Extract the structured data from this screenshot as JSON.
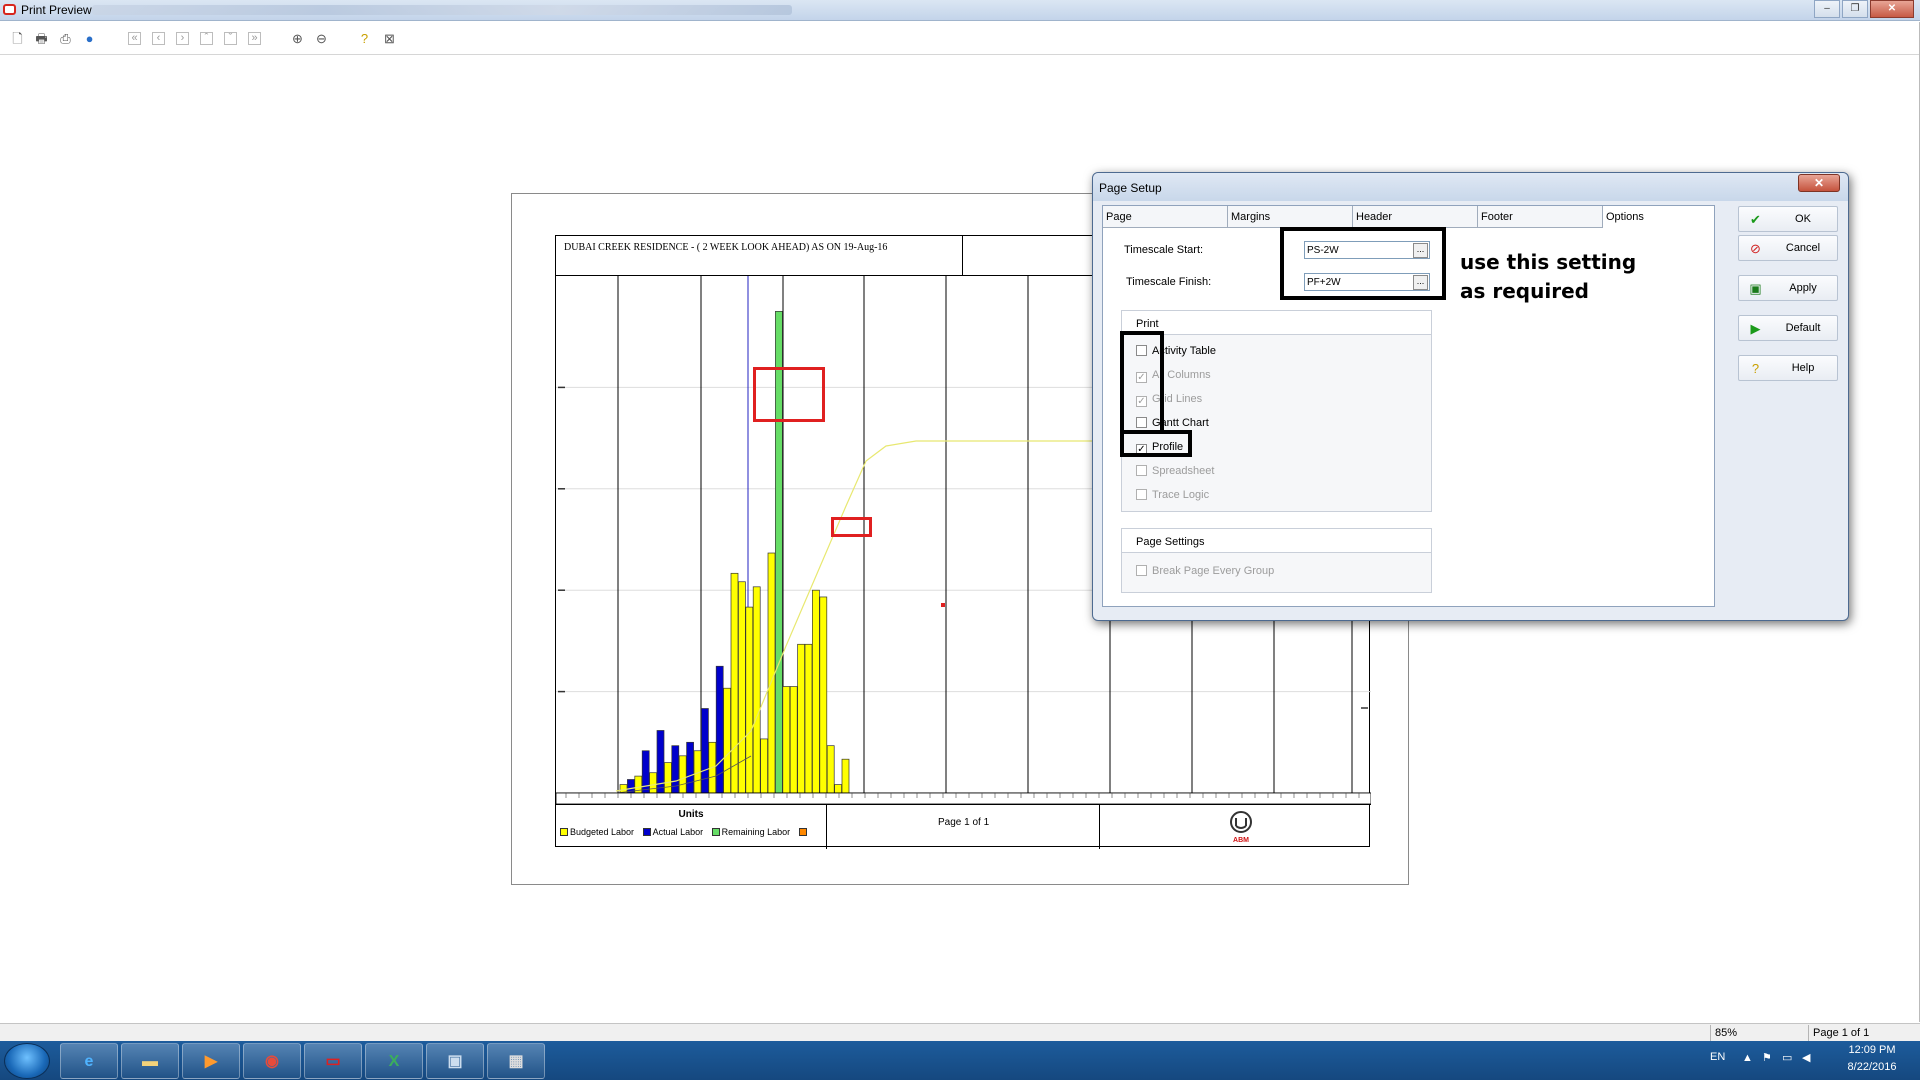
{
  "window": {
    "title": "Print Preview",
    "minimize": "–",
    "restore": "❐",
    "close": "✕"
  },
  "toolbar": {
    "icons": [
      "page-setup-icon",
      "print-preview-icon",
      "print-icon",
      "publish-icon",
      "first-page-icon",
      "prev-page-icon",
      "next-page-icon",
      "up-page-icon",
      "down-page-icon",
      "last-page-icon",
      "zoom-in-icon",
      "zoom-out-icon",
      "help-icon",
      "close-preview-icon"
    ]
  },
  "report": {
    "title": "DUBAI CREEK RESIDENCE - ( 2 WEEK LOOK AHEAD) AS ON 19-Aug-16",
    "units_label": "Units",
    "legend": [
      {
        "label": "Budgeted Labor",
        "color": "#ffff00"
      },
      {
        "label": "Actual Labor",
        "color": "#0000cc"
      },
      {
        "label": "Remaining Labor",
        "color": "#66dd66"
      },
      {
        "label": "",
        "color": "#ff8800"
      }
    ],
    "page_of": "Page 1 of 1",
    "logo_text": "ABM"
  },
  "chart_data": {
    "type": "bar",
    "series": [
      {
        "name": "Budgeted Labor",
        "color": "#ffff00",
        "values": [
          0.5,
          1.0,
          1.2,
          1.8,
          2.2,
          2.5,
          3.0,
          6.2,
          13.0,
          12.5,
          11.0,
          12.2,
          3.2,
          14.2,
          6.3,
          6.3,
          8.8,
          8.8,
          12.0,
          11.6,
          2.8,
          0.5,
          2.0,
          0
        ]
      },
      {
        "name": "Actual Labor",
        "color": "#0000cc",
        "values": [
          0.8,
          2.5,
          3.7,
          2.8,
          3.0,
          5.0,
          7.5,
          0,
          0,
          0,
          0,
          0,
          0,
          0,
          0,
          0,
          0,
          0,
          0,
          0,
          0,
          0,
          0,
          0
        ]
      },
      {
        "name": "Remaining Labor",
        "color": "#66dd66",
        "values": [
          0,
          0,
          0,
          0,
          0,
          0,
          0,
          0,
          0,
          0,
          0,
          0,
          0,
          28.5,
          0,
          0,
          0,
          0,
          0,
          0,
          0,
          0,
          0,
          0
        ]
      }
    ]
  },
  "dialog": {
    "title": "Page Setup",
    "close": "✕",
    "tabs": [
      "Page",
      "Margins",
      "Header",
      "Footer",
      "Options"
    ],
    "timescale_start_label": "Timescale Start:",
    "timescale_start_value": "PS-2W",
    "timescale_finish_label": "Timescale Finish:",
    "timescale_finish_value": "PF+2W",
    "ellipsis": "...",
    "print_group": "Print",
    "print_options": [
      {
        "label": "Activity Table",
        "checked": false,
        "enabled": true
      },
      {
        "label": "All Columns",
        "checked": true,
        "enabled": false
      },
      {
        "label": "Grid Lines",
        "checked": true,
        "enabled": false
      },
      {
        "label": "Gantt Chart",
        "checked": false,
        "enabled": true
      },
      {
        "label": "Profile",
        "checked": true,
        "enabled": true
      },
      {
        "label": "Spreadsheet",
        "checked": false,
        "enabled": false
      },
      {
        "label": "Trace Logic",
        "checked": false,
        "enabled": false
      }
    ],
    "page_settings_group": "Page Settings",
    "break_page_label": "Break Page Every Group",
    "buttons": {
      "ok": "OK",
      "cancel": "Cancel",
      "apply": "Apply",
      "default": "Default",
      "help": "Help"
    }
  },
  "annotation": "use this setting as required",
  "status": {
    "zoom": "85%",
    "page": "Page 1 of 1"
  },
  "tray": {
    "lang": "EN",
    "time": "12:09 PM",
    "date": "8/22/2016"
  }
}
